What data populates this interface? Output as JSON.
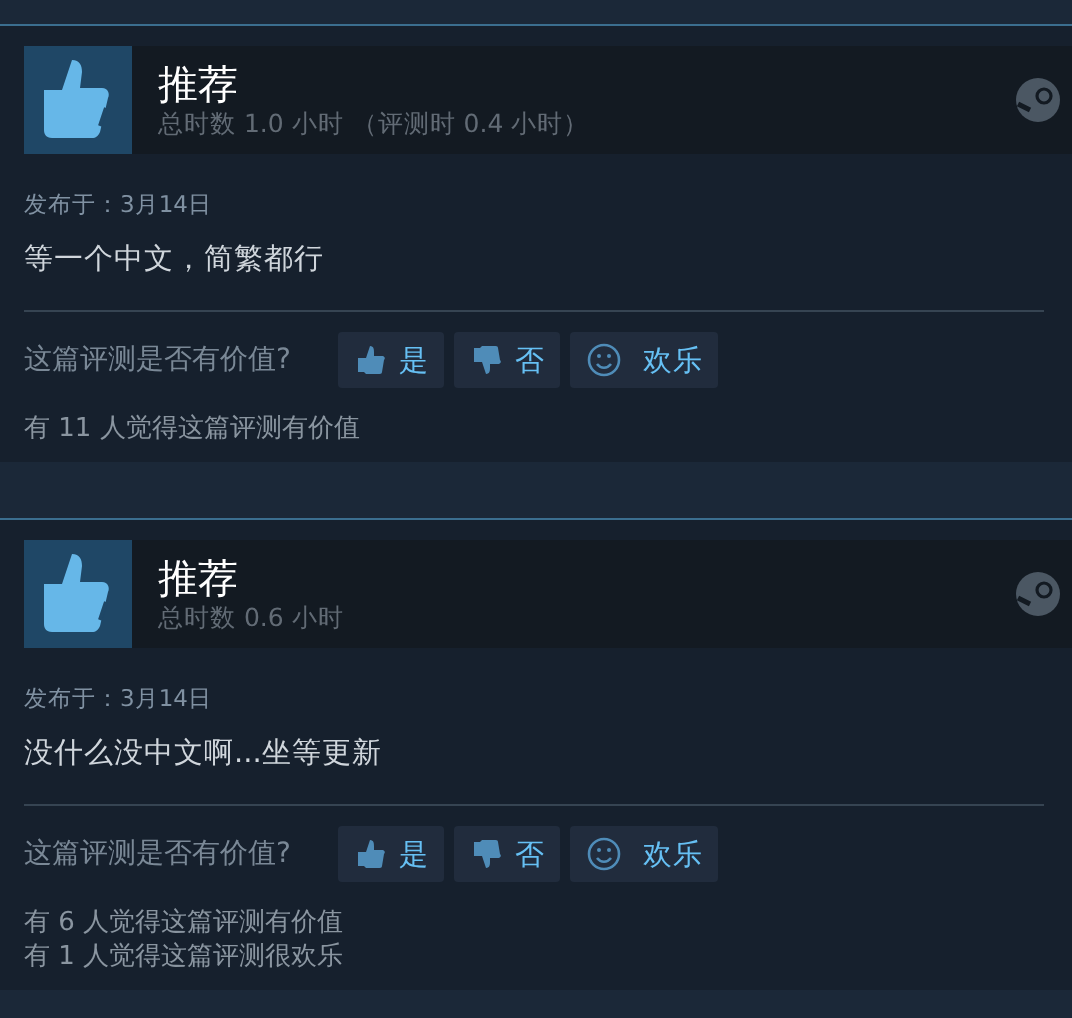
{
  "reviews": [
    {
      "verdict": "推荐",
      "recommended": true,
      "hours": "总时数 1.0 小时 （评测时 0.4 小时）",
      "posted": "发布于：3月14日",
      "text": "等一个中文，简繁都行",
      "vote_prompt": "这篇评测是否有价值?",
      "vote_buttons": [
        {
          "kind": "yes",
          "label": "是"
        },
        {
          "kind": "no",
          "label": "否"
        },
        {
          "kind": "funny",
          "label": "欢乐"
        }
      ],
      "stats": [
        "有 11 人觉得这篇评测有价值"
      ]
    },
    {
      "verdict": "推荐",
      "recommended": true,
      "hours": "总时数 0.6 小时",
      "posted": "发布于：3月14日",
      "text": "没什么没中文啊...坐等更新",
      "vote_prompt": "这篇评测是否有价值?",
      "vote_buttons": [
        {
          "kind": "yes",
          "label": "是"
        },
        {
          "kind": "no",
          "label": "否"
        },
        {
          "kind": "funny",
          "label": "欢乐"
        }
      ],
      "stats": [
        "有 6 人觉得这篇评测有价值",
        "有 1 人觉得这篇评测很欢乐"
      ]
    }
  ]
}
